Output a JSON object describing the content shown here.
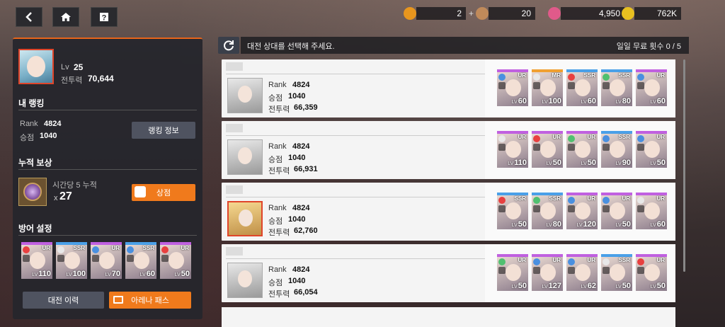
{
  "nav": {
    "back_icon": "back-arrow-icon",
    "home_icon": "home-icon",
    "help_icon": "help-icon"
  },
  "resources": [
    {
      "icon": "ticket-icon",
      "value": "2",
      "color": "#e8961e",
      "plus": "+"
    },
    {
      "icon": "medal-icon",
      "value": "20",
      "color": "#c08a5a",
      "plus": ""
    },
    {
      "icon": "gem-icon",
      "value": "4,950",
      "color": "#e05a8a",
      "plus": "+"
    },
    {
      "icon": "coin-icon",
      "value": "762K",
      "color": "#e8c020",
      "plus": ""
    }
  ],
  "player": {
    "lv_label": "Lv",
    "lv": "25",
    "power_label": "전투력",
    "power": "70,644"
  },
  "ranking": {
    "title": "내 랭킹",
    "rank_label": "Rank",
    "rank": "4824",
    "points_label": "승점",
    "points": "1040",
    "info_button": "랭킹 정보"
  },
  "reward": {
    "title": "누적 보상",
    "desc": "시간당 5 누적",
    "count_prefix": "x",
    "count": "27",
    "shop_button": "상점"
  },
  "defense": {
    "title": "방어 설정",
    "team": [
      {
        "rar": "UR",
        "lv": "110",
        "el": "#e84040",
        "c": "#c060e0"
      },
      {
        "rar": "SSR",
        "lv": "100",
        "el": "#e8e8e8",
        "c": "#c060e0"
      },
      {
        "rar": "UR",
        "lv": "70",
        "el": "#4a90e0",
        "c": "#c060e0"
      },
      {
        "rar": "SSR",
        "lv": "60",
        "el": "#4a90e0",
        "c": "#c060e0"
      },
      {
        "rar": "UR",
        "lv": "50",
        "el": "#e84040",
        "c": "#c060e0"
      }
    ],
    "history_button": "대전 이력",
    "pass_button": "아레나 패스"
  },
  "lv_small": "LV",
  "info": {
    "text": "대전 상대를 선택해 주세요.",
    "daily_label": "일일 무료 횟수",
    "daily": "0 / 5"
  },
  "opponents": [
    {
      "rank_label": "Rank",
      "rank": "4824",
      "points_label": "승점",
      "points": "1040",
      "power_label": "전투력",
      "power": "66,359",
      "red": false,
      "team": [
        {
          "rar": "UR",
          "lv": "60"
        },
        {
          "rar": "MR",
          "lv": "100"
        },
        {
          "rar": "SSR",
          "lv": "60"
        },
        {
          "rar": "SSR",
          "lv": "80"
        },
        {
          "rar": "UR",
          "lv": "60"
        }
      ]
    },
    {
      "rank_label": "Rank",
      "rank": "4824",
      "points_label": "승점",
      "points": "1040",
      "power_label": "전투력",
      "power": "66,931",
      "red": false,
      "team": [
        {
          "rar": "UR",
          "lv": "110"
        },
        {
          "rar": "UR",
          "lv": "50"
        },
        {
          "rar": "UR",
          "lv": "50"
        },
        {
          "rar": "SSR",
          "lv": "90"
        },
        {
          "rar": "UR",
          "lv": "50"
        }
      ]
    },
    {
      "rank_label": "Rank",
      "rank": "4824",
      "points_label": "승점",
      "points": "1040",
      "power_label": "전투력",
      "power": "62,760",
      "red": true,
      "team": [
        {
          "rar": "SSR",
          "lv": "50"
        },
        {
          "rar": "SSR",
          "lv": "80"
        },
        {
          "rar": "UR",
          "lv": "120"
        },
        {
          "rar": "UR",
          "lv": "50"
        },
        {
          "rar": "UR",
          "lv": "60"
        }
      ]
    },
    {
      "rank_label": "Rank",
      "rank": "4824",
      "points_label": "승점",
      "points": "1040",
      "power_label": "전투력",
      "power": "66,054",
      "red": false,
      "team": [
        {
          "rar": "UR",
          "lv": "50"
        },
        {
          "rar": "UR",
          "lv": "127"
        },
        {
          "rar": "UR",
          "lv": "62"
        },
        {
          "rar": "SSR",
          "lv": "50"
        },
        {
          "rar": "UR",
          "lv": "50"
        }
      ]
    }
  ]
}
